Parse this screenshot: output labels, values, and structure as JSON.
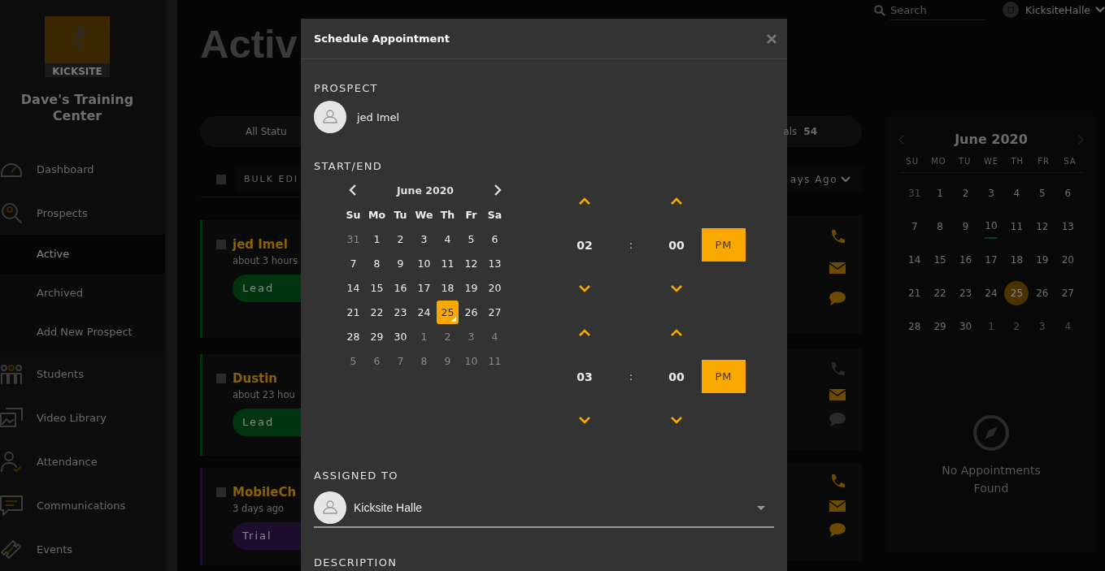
{
  "sidebar": {
    "brand": "KICKSITE",
    "school": "Dave's Training Center",
    "nav": [
      {
        "kind": "gauge",
        "label": "Dashboard",
        "selected": false
      },
      {
        "kind": "search-person",
        "label": "Prospects",
        "selected": false,
        "children": [
          {
            "label": "Active",
            "selected": true
          },
          {
            "label": "Archived",
            "selected": false
          },
          {
            "label": "Add New Prospect",
            "selected": false
          }
        ]
      },
      {
        "kind": "people",
        "label": "Students",
        "selected": false
      },
      {
        "kind": "photo",
        "label": "Video Library",
        "selected": false
      },
      {
        "kind": "person-check",
        "label": "Attendance",
        "selected": false
      },
      {
        "kind": "chat",
        "label": "Communications",
        "selected": false
      },
      {
        "kind": "ticket",
        "label": "Events",
        "selected": false
      }
    ]
  },
  "page": {
    "title": "Activ",
    "status_filter": "All Statu",
    "totals_label": "als",
    "totals_count": "54",
    "bulk_edit": "BULK EDI",
    "bulk_checked": false,
    "sort": "ays Ago"
  },
  "prospects": [
    {
      "name": "jed Imel",
      "checked": false,
      "time": "about 3 hours",
      "status": "Lead",
      "color": "#00330f",
      "contacts": [
        {
          "kind": "phone",
          "disabled": false
        },
        {
          "kind": "email",
          "disabled": false
        },
        {
          "kind": "sms",
          "disabled": false
        }
      ]
    },
    {
      "name": "Dustin",
      "checked": false,
      "time": "about 23 hou",
      "status": "Lead",
      "color": "#00330f",
      "contacts": [
        {
          "kind": "phone",
          "disabled": true
        },
        {
          "kind": "email",
          "disabled": false
        },
        {
          "kind": "sms",
          "disabled": true
        }
      ]
    },
    {
      "name": "MobileCh",
      "checked": false,
      "time": "3 days ago",
      "status": "Trial",
      "color": "#1c0c2e",
      "contacts": [
        {
          "kind": "phone",
          "disabled": false
        },
        {
          "kind": "email",
          "disabled": false
        },
        {
          "kind": "sms",
          "disabled": false
        }
      ]
    }
  ],
  "topbar": {
    "search_placeholder": "Search",
    "user": "KicksiteHalle"
  },
  "mini_calendar": {
    "month": "June 2020",
    "weekdays": [
      "SU",
      "MO",
      "TU",
      "WE",
      "TH",
      "FR",
      "SA"
    ],
    "empty_text": "No Appointments Found",
    "weeks": [
      [
        {
          "d": "31",
          "outside": true,
          "selected": false,
          "event": false
        },
        {
          "d": "1",
          "outside": false,
          "selected": false,
          "event": false
        },
        {
          "d": "2",
          "outside": false,
          "selected": false,
          "event": false
        },
        {
          "d": "3",
          "outside": false,
          "selected": false,
          "event": false
        },
        {
          "d": "4",
          "outside": false,
          "selected": false,
          "event": false
        },
        {
          "d": "5",
          "outside": false,
          "selected": false,
          "event": false
        },
        {
          "d": "6",
          "outside": false,
          "selected": false,
          "event": false
        }
      ],
      [
        {
          "d": "7",
          "outside": false,
          "selected": false,
          "event": false
        },
        {
          "d": "8",
          "outside": false,
          "selected": false,
          "event": false
        },
        {
          "d": "9",
          "outside": false,
          "selected": false,
          "event": false
        },
        {
          "d": "10",
          "outside": false,
          "selected": false,
          "event": true
        },
        {
          "d": "11",
          "outside": false,
          "selected": false,
          "event": false
        },
        {
          "d": "12",
          "outside": false,
          "selected": false,
          "event": false
        },
        {
          "d": "13",
          "outside": false,
          "selected": false,
          "event": false
        }
      ],
      [
        {
          "d": "14",
          "outside": false,
          "selected": false,
          "event": false
        },
        {
          "d": "15",
          "outside": false,
          "selected": false,
          "event": false
        },
        {
          "d": "16",
          "outside": false,
          "selected": false,
          "event": false
        },
        {
          "d": "17",
          "outside": false,
          "selected": false,
          "event": false
        },
        {
          "d": "18",
          "outside": false,
          "selected": false,
          "event": false
        },
        {
          "d": "19",
          "outside": false,
          "selected": false,
          "event": false
        },
        {
          "d": "20",
          "outside": false,
          "selected": false,
          "event": false
        }
      ],
      [
        {
          "d": "21",
          "outside": false,
          "selected": false,
          "event": false
        },
        {
          "d": "22",
          "outside": false,
          "selected": false,
          "event": false
        },
        {
          "d": "23",
          "outside": false,
          "selected": false,
          "event": false
        },
        {
          "d": "24",
          "outside": false,
          "selected": false,
          "event": false
        },
        {
          "d": "25",
          "outside": false,
          "selected": true,
          "event": false
        },
        {
          "d": "26",
          "outside": false,
          "selected": false,
          "event": false
        },
        {
          "d": "27",
          "outside": false,
          "selected": false,
          "event": false
        }
      ],
      [
        {
          "d": "28",
          "outside": false,
          "selected": false,
          "event": false
        },
        {
          "d": "29",
          "outside": false,
          "selected": false,
          "event": false
        },
        {
          "d": "30",
          "outside": false,
          "selected": false,
          "event": false
        },
        {
          "d": "1",
          "outside": true,
          "selected": false,
          "event": false
        },
        {
          "d": "2",
          "outside": true,
          "selected": false,
          "event": false
        },
        {
          "d": "3",
          "outside": true,
          "selected": false,
          "event": false
        },
        {
          "d": "4",
          "outside": true,
          "selected": false,
          "event": false
        }
      ]
    ]
  },
  "modal": {
    "title": "Schedule Appointment",
    "prospect_label": "PROSPECT",
    "prospect_name": "jed Imel",
    "start_end_label": "START/END",
    "calendar": {
      "month": "June 2020",
      "weekdays": [
        "Su",
        "Mo",
        "Tu",
        "We",
        "Th",
        "Fr",
        "Sa"
      ],
      "weeks": [
        [
          {
            "d": "31",
            "outside": true,
            "selected": false
          },
          {
            "d": "1",
            "outside": false,
            "selected": false
          },
          {
            "d": "2",
            "outside": false,
            "selected": false
          },
          {
            "d": "3",
            "outside": false,
            "selected": false
          },
          {
            "d": "4",
            "outside": false,
            "selected": false
          },
          {
            "d": "5",
            "outside": false,
            "selected": false
          },
          {
            "d": "6",
            "outside": false,
            "selected": false
          }
        ],
        [
          {
            "d": "7",
            "outside": false,
            "selected": false
          },
          {
            "d": "8",
            "outside": false,
            "selected": false
          },
          {
            "d": "9",
            "outside": false,
            "selected": false
          },
          {
            "d": "10",
            "outside": false,
            "selected": false
          },
          {
            "d": "11",
            "outside": false,
            "selected": false
          },
          {
            "d": "12",
            "outside": false,
            "selected": false
          },
          {
            "d": "13",
            "outside": false,
            "selected": false
          }
        ],
        [
          {
            "d": "14",
            "outside": false,
            "selected": false
          },
          {
            "d": "15",
            "outside": false,
            "selected": false
          },
          {
            "d": "16",
            "outside": false,
            "selected": false
          },
          {
            "d": "17",
            "outside": false,
            "selected": false
          },
          {
            "d": "18",
            "outside": false,
            "selected": false
          },
          {
            "d": "19",
            "outside": false,
            "selected": false
          },
          {
            "d": "20",
            "outside": false,
            "selected": false
          }
        ],
        [
          {
            "d": "21",
            "outside": false,
            "selected": false
          },
          {
            "d": "22",
            "outside": false,
            "selected": false
          },
          {
            "d": "23",
            "outside": false,
            "selected": false
          },
          {
            "d": "24",
            "outside": false,
            "selected": false
          },
          {
            "d": "25",
            "outside": false,
            "selected": true
          },
          {
            "d": "26",
            "outside": false,
            "selected": false
          },
          {
            "d": "27",
            "outside": false,
            "selected": false
          }
        ],
        [
          {
            "d": "28",
            "outside": false,
            "selected": false
          },
          {
            "d": "29",
            "outside": false,
            "selected": false
          },
          {
            "d": "30",
            "outside": false,
            "selected": false
          },
          {
            "d": "1",
            "outside": true,
            "selected": false
          },
          {
            "d": "2",
            "outside": true,
            "selected": false
          },
          {
            "d": "3",
            "outside": true,
            "selected": false
          },
          {
            "d": "4",
            "outside": true,
            "selected": false
          }
        ],
        [
          {
            "d": "5",
            "outside": true,
            "selected": false
          },
          {
            "d": "6",
            "outside": true,
            "selected": false
          },
          {
            "d": "7",
            "outside": true,
            "selected": false
          },
          {
            "d": "8",
            "outside": true,
            "selected": false
          },
          {
            "d": "9",
            "outside": true,
            "selected": false
          },
          {
            "d": "10",
            "outside": true,
            "selected": false
          },
          {
            "d": "11",
            "outside": true,
            "selected": false
          }
        ]
      ]
    },
    "times": [
      {
        "hour": "02",
        "separator": ":",
        "minute": "00",
        "meridiem": "PM"
      },
      {
        "hour": "03",
        "separator": ":",
        "minute": "00",
        "meridiem": "PM"
      }
    ],
    "assigned_label": "ASSIGNED TO",
    "assignee": "Kicksite Halle",
    "description_label": "DESCRIPTION"
  }
}
